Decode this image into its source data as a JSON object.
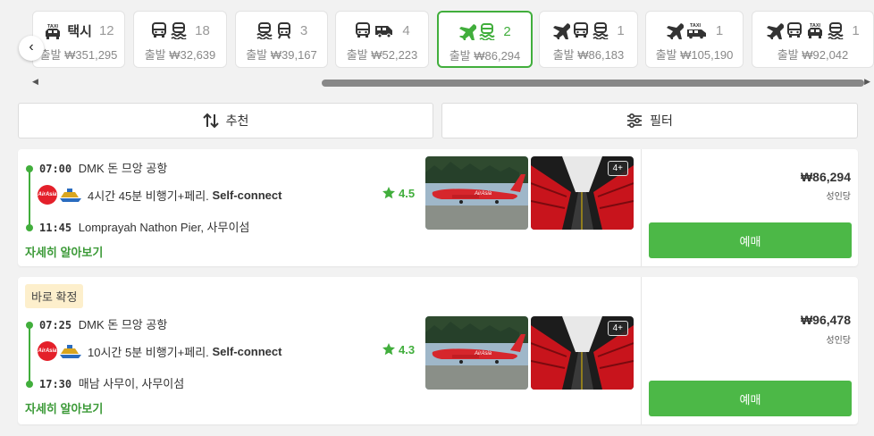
{
  "tabs": [
    {
      "icons": [
        "taxi-icon"
      ],
      "label": "택시",
      "count": "12",
      "price": "출발 ₩351,295"
    },
    {
      "icons": [
        "bus-icon",
        "ferry-icon"
      ],
      "count": "18",
      "price": "출발 ₩32,639"
    },
    {
      "icons": [
        "ferry-icon",
        "train-icon"
      ],
      "count": "3",
      "price": "출발 ₩39,167"
    },
    {
      "icons": [
        "bus-icon",
        "van-icon"
      ],
      "count": "4",
      "price": "출발 ₩52,223"
    },
    {
      "icons": [
        "plane-icon",
        "ferry-icon"
      ],
      "count": "2",
      "price": "출발 ₩86,294"
    },
    {
      "icons": [
        "plane-icon",
        "bus-icon",
        "ferry-icon"
      ],
      "count": "1",
      "price": "출발 ₩86,183"
    },
    {
      "icons": [
        "plane-icon",
        "taxi-van-icon"
      ],
      "count": "1",
      "price": "출발 ₩105,190"
    },
    {
      "icons": [
        "plane-icon",
        "bus-icon",
        "taxi-icon",
        "ferry-icon"
      ],
      "count": "1",
      "price": "출발 ₩92,042"
    }
  ],
  "active_tab": 4,
  "sort": {
    "label": "추천"
  },
  "filter": {
    "label": "필터"
  },
  "results": [
    {
      "badge": "",
      "dep_time": "07:00",
      "dep_place": "DMK 돈 므앙 공항",
      "duration": "4시간 45분 비행기+페리.",
      "connect": "Self-connect",
      "rating": "4.5",
      "arr_time": "11:45",
      "arr_place": "Lomprayah Nathon Pier, 사무이섬",
      "more": "자세히 알아보기",
      "photos_more": "4+",
      "price": "₩86,294",
      "price_unit": "성인당",
      "book": "예매"
    },
    {
      "badge": "바로 확정",
      "dep_time": "07:25",
      "dep_place": "DMK 돈 므앙 공항",
      "duration": "10시간 5분 비행기+페리.",
      "connect": "Self-connect",
      "rating": "4.3",
      "arr_time": "17:30",
      "arr_place": "매남 사무이, 사무이섬",
      "more": "자세히 알아보기",
      "photos_more": "4+",
      "price": "₩96,478",
      "price_unit": "성인당",
      "book": "예매"
    }
  ],
  "colors": {
    "accent": "#41ae3c",
    "button": "#4cb847",
    "badge_bg": "#fdefcc",
    "airline": "#e4202a"
  }
}
